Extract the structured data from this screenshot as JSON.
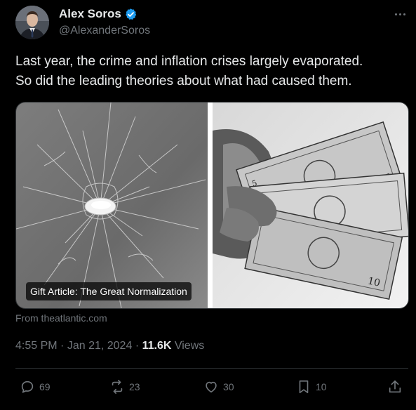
{
  "author": {
    "display_name": "Alex Soros",
    "handle": "@AlexanderSoros",
    "verified": true,
    "avatar_icon": "profile-photo"
  },
  "tweet": {
    "text_lines": [
      "Last year, the crime and inflation crises largely evaporated.",
      "So did the leading theories about what had caused them."
    ]
  },
  "card": {
    "label": "Gift Article: The Great Normalization",
    "source": "From theatlantic.com",
    "left_image": "shattered-glass-bullet-hole",
    "right_image": "hand-holding-dollar-bills"
  },
  "meta": {
    "time": "4:55 PM",
    "date": "Jan 21, 2024",
    "separator": "·",
    "views_count": "11.6K",
    "views_label": "Views"
  },
  "actions": {
    "replies": "69",
    "reposts": "23",
    "likes": "30",
    "bookmarks": "10"
  },
  "colors": {
    "background": "#000000",
    "text": "#e7e9ea",
    "muted": "#71767b",
    "verified_blue": "#1d9bf0",
    "border": "#2f3336"
  }
}
